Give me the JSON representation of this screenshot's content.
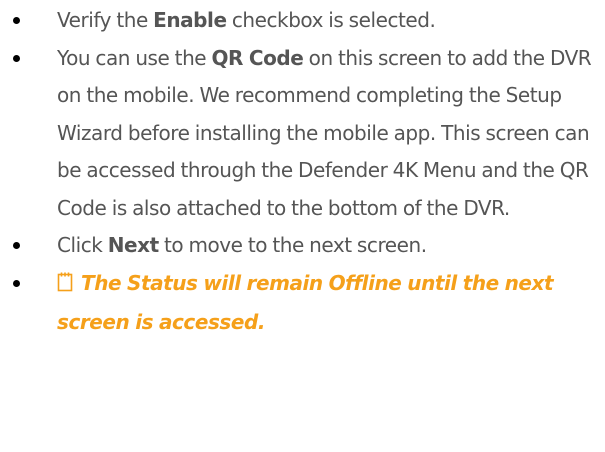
{
  "list_items": [
    {
      "pre": "Verify the ",
      "bold": "Enable",
      "post": " checkbox is selected."
    },
    {
      "pre": "You can use the ",
      "bold": "QR Code",
      "post": " on this screen to add the DVR on the mobile. We recommend completing the Setup Wizard before installing the mobile app. This screen can be accessed through the Defender 4K Menu and the QR Code is also attached to the bottom of the DVR."
    },
    {
      "pre": "Click ",
      "bold": "Next",
      "post": " to move to the next screen."
    },
    {
      "icon": "note-icon",
      "note": "The Status will remain Offline until the next screen is accessed."
    }
  ],
  "colors": {
    "text": "#555555",
    "note": "#f5a01a",
    "bullet": "#000000"
  }
}
